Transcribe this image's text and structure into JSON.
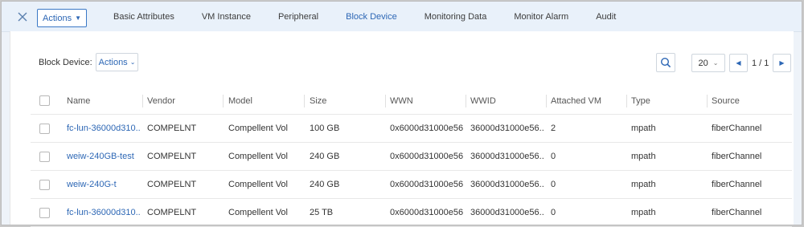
{
  "header": {
    "actions_label": "Actions",
    "tabs": [
      {
        "label": "Basic Attributes"
      },
      {
        "label": "VM Instance"
      },
      {
        "label": "Peripheral"
      },
      {
        "label": "Block Device",
        "active": true
      },
      {
        "label": "Monitoring Data"
      },
      {
        "label": "Monitor Alarm"
      },
      {
        "label": "Audit"
      }
    ]
  },
  "toolbar": {
    "label": "Block Device:",
    "actions_label": "Actions",
    "page_size": "20",
    "page_info": "1 / 1"
  },
  "table": {
    "columns": [
      "Name",
      "Vendor",
      "Model",
      "Size",
      "WWN",
      "WWID",
      "Attached VM",
      "Type",
      "Source"
    ],
    "rows": [
      [
        "fc-lun-36000d310...",
        "COMPELNT",
        "Compellent Vol",
        "100 GB",
        "0x6000d31000e56...",
        "36000d31000e56...",
        "2",
        "mpath",
        "fiberChannel"
      ],
      [
        "weiw-240GB-test",
        "COMPELNT",
        "Compellent Vol",
        "240 GB",
        "0x6000d31000e56...",
        "36000d31000e56...",
        "0",
        "mpath",
        "fiberChannel"
      ],
      [
        "weiw-240G-t",
        "COMPELNT",
        "Compellent Vol",
        "240 GB",
        "0x6000d31000e56...",
        "36000d31000e56...",
        "0",
        "mpath",
        "fiberChannel"
      ],
      [
        "fc-lun-36000d310...",
        "COMPELNT",
        "Compellent Vol",
        "25 TB",
        "0x6000d31000e56...",
        "36000d31000e56...",
        "0",
        "mpath",
        "fiberChannel"
      ]
    ]
  },
  "icons": {
    "close": "close-icon",
    "search": "search-icon",
    "dropdown": "chevron-down-icon",
    "prev": "caret-left-icon",
    "next": "caret-right-icon"
  },
  "colors": {
    "accent": "#2d67b5",
    "topbar_bg": "#e9f1fa"
  }
}
